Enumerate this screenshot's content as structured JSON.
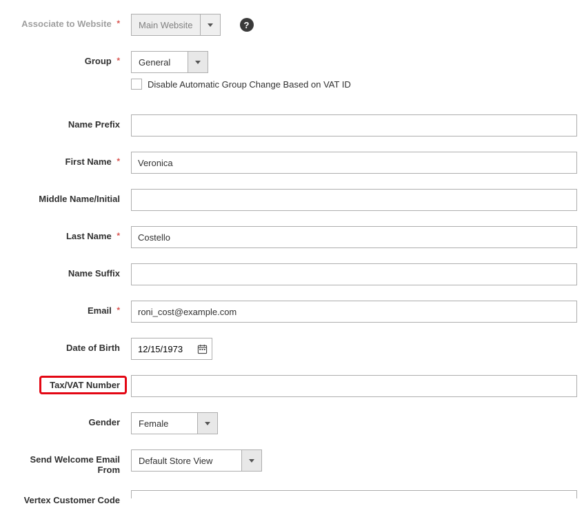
{
  "fields": {
    "associate_website": {
      "label": "Associate to Website",
      "value": "Main Website",
      "required": true
    },
    "group": {
      "label": "Group",
      "value": "General",
      "required": true
    },
    "disable_auto_group": {
      "label": "Disable Automatic Group Change Based on VAT ID",
      "checked": false
    },
    "name_prefix": {
      "label": "Name Prefix",
      "value": ""
    },
    "first_name": {
      "label": "First Name",
      "value": "Veronica",
      "required": true
    },
    "middle_name": {
      "label": "Middle Name/Initial",
      "value": ""
    },
    "last_name": {
      "label": "Last Name",
      "value": "Costello",
      "required": true
    },
    "name_suffix": {
      "label": "Name Suffix",
      "value": ""
    },
    "email": {
      "label": "Email",
      "value": "roni_cost@example.com",
      "required": true
    },
    "dob": {
      "label": "Date of Birth",
      "value": "12/15/1973"
    },
    "tax_vat": {
      "label": "Tax/VAT Number",
      "value": ""
    },
    "gender": {
      "label": "Gender",
      "value": "Female"
    },
    "welcome_from": {
      "label": "Send Welcome Email From",
      "value": "Default Store View"
    },
    "vertex_code": {
      "label": "Vertex Customer Code",
      "value": ""
    }
  }
}
